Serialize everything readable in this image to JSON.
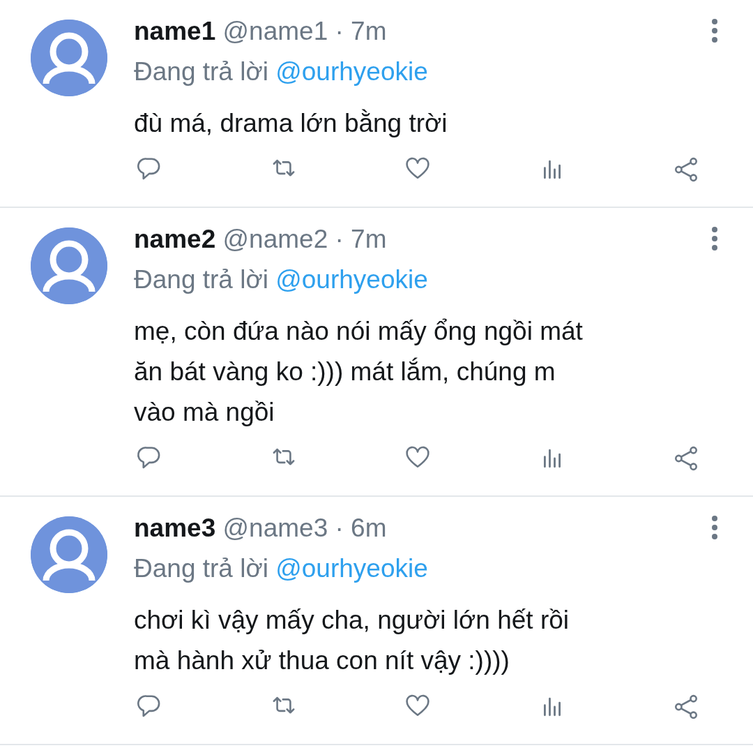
{
  "tweets": [
    {
      "name": "name1",
      "handle": "@name1",
      "separator": "·",
      "time": "7m",
      "reply_label": "Đang trả lời",
      "reply_to": "@ourhyeokie",
      "text": "đù má, drama lớn bằng trời"
    },
    {
      "name": "name2",
      "handle": "@name2",
      "separator": "·",
      "time": "7m",
      "reply_label": "Đang trả lời",
      "reply_to": "@ourhyeokie",
      "text": "mẹ, còn đứa nào nói mấy ổng ngồi mát\năn bát vàng ko :))) mát lắm, chúng m\nvào mà ngồi"
    },
    {
      "name": "name3",
      "handle": "@name3",
      "separator": "·",
      "time": "6m",
      "reply_label": "Đang trả lời",
      "reply_to": "@ourhyeokie",
      "text": "chơi kì vậy mấy cha, người lớn hết rồi\nmà hành xử thua con nít vậy :))))"
    }
  ]
}
